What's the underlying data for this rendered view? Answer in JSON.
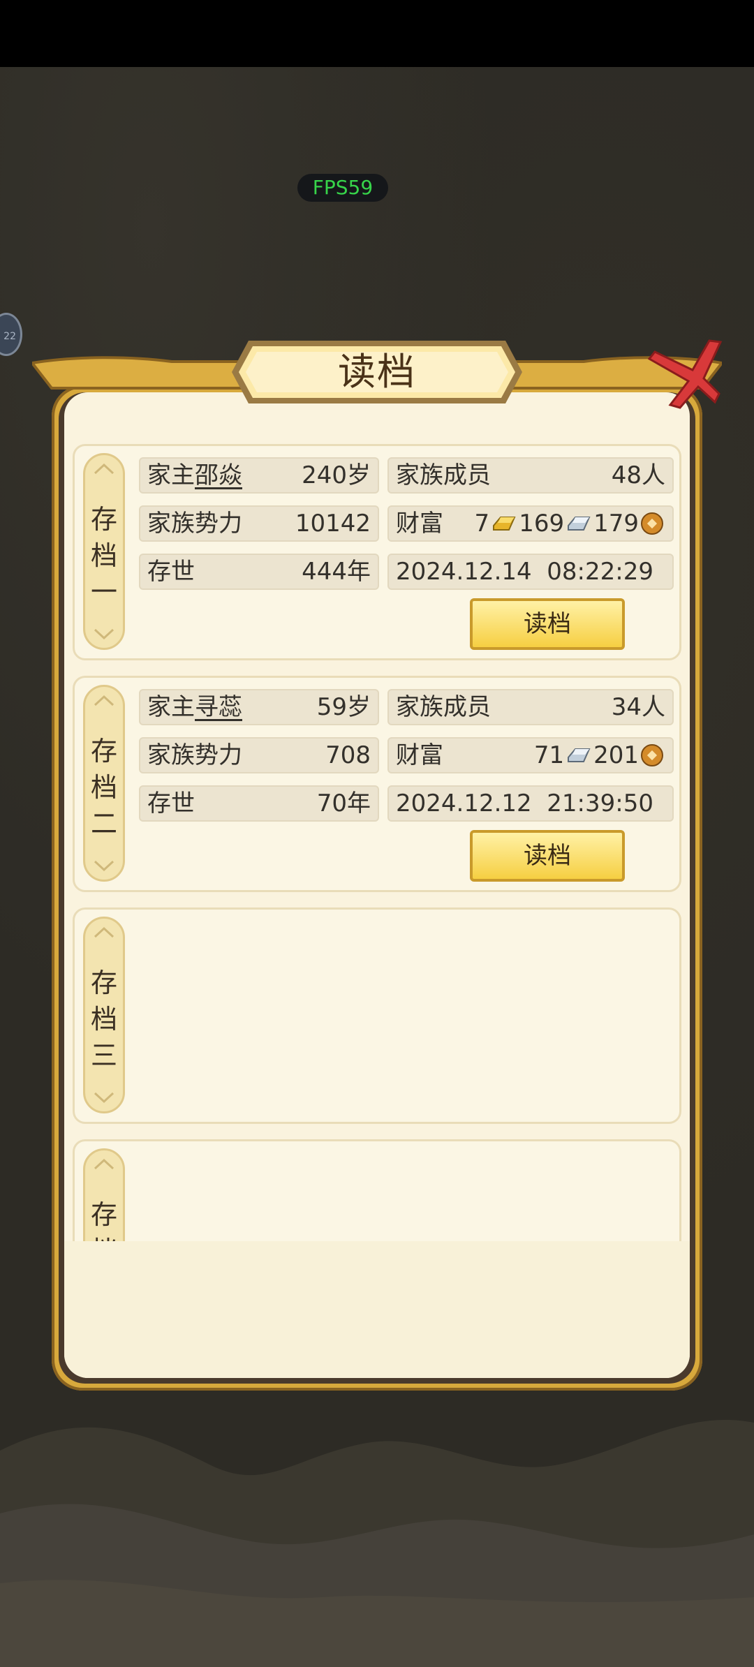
{
  "fps_label": "FPS59",
  "side_badge": "22",
  "dialog": {
    "title": "读档",
    "slots": [
      {
        "tab_label": "存\n档\n一",
        "head_label": "家主",
        "head_name": "邵焱",
        "head_age": "240岁",
        "members_label": "家族成员",
        "members_value": "48人",
        "power_label": "家族势力",
        "power_value": "10142",
        "wealth_label": "财富",
        "wealth_gold": "7",
        "wealth_silver": "169",
        "wealth_copper": "179",
        "era_label": "存世",
        "era_value": "444年",
        "saved_at": "2024.12.14  08:22:29",
        "load_label": "读档"
      },
      {
        "tab_label": "存\n档\n二",
        "head_label": "家主",
        "head_name": "寻蕊",
        "head_age": "59岁",
        "members_label": "家族成员",
        "members_value": "34人",
        "power_label": "家族势力",
        "power_value": "708",
        "wealth_label": "财富",
        "wealth_silver": "71",
        "wealth_copper": "201",
        "era_label": "存世",
        "era_value": "70年",
        "saved_at": "2024.12.12  21:39:50",
        "load_label": "读档"
      },
      {
        "tab_label": "存\n档\n三"
      },
      {
        "tab_label": "存\n档"
      }
    ]
  },
  "colors": {
    "frame_gold": "#d8a93c",
    "panel_bg": "#faf3de",
    "button_gold": "#f6cf42",
    "fps_green": "#37d44a"
  },
  "icons": [
    "gold-ingot-icon",
    "silver-ingot-icon",
    "copper-coin-icon",
    "close-icon",
    "chevron-up-icon",
    "chevron-down-icon"
  ]
}
